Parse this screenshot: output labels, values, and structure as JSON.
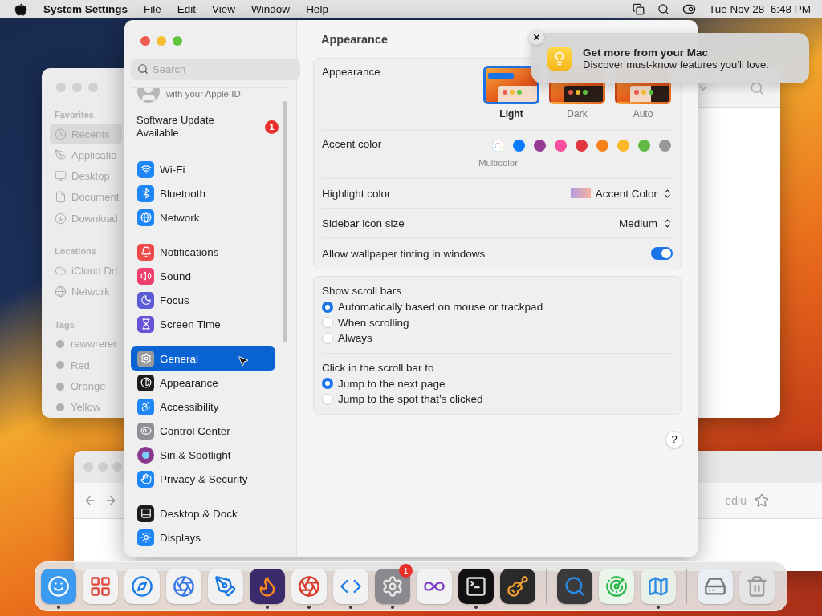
{
  "menubar": {
    "app": "System Settings",
    "menus": [
      "File",
      "Edit",
      "View",
      "Window",
      "Help"
    ],
    "clock": "Tue Nov 28  6:48 PM"
  },
  "finder": {
    "sections": [
      {
        "title": "Favorites",
        "kind": "places",
        "items": [
          {
            "label": "Recents",
            "selected": true
          },
          {
            "label": "Applicatio",
            "selected": false
          },
          {
            "label": "Desktop",
            "selected": false
          },
          {
            "label": "Document",
            "selected": false
          },
          {
            "label": "Download",
            "selected": false
          }
        ]
      },
      {
        "title": "Locations",
        "kind": "places",
        "items": [
          {
            "label": "iCloud Dri",
            "selected": false
          },
          {
            "label": "Network",
            "selected": false
          }
        ]
      },
      {
        "title": "Tags",
        "kind": "tags",
        "items": [
          {
            "label": "rewwrerer",
            "selected": false
          },
          {
            "label": "Red",
            "selected": false
          },
          {
            "label": "Orange",
            "selected": false
          },
          {
            "label": "Yellow",
            "selected": false
          }
        ]
      }
    ]
  },
  "browser": {
    "address_text": "ediu"
  },
  "settings": {
    "search": {
      "placeholder": "Search"
    },
    "account": {
      "subtitle": "with your Apple ID"
    },
    "update": {
      "label": "Software Update Available",
      "badge": "1"
    },
    "sidebar_groups": [
      [
        {
          "label": "Wi-Fi",
          "color": "#1e86f5",
          "selected": false
        },
        {
          "label": "Bluetooth",
          "color": "#1e86f5",
          "selected": false
        },
        {
          "label": "Network",
          "color": "#1e86f5",
          "selected": false
        }
      ],
      [
        {
          "label": "Notifications",
          "color": "#ec4a4a",
          "selected": false
        },
        {
          "label": "Sound",
          "color": "#ec3f6b",
          "selected": false
        },
        {
          "label": "Focus",
          "color": "#5b5bd6",
          "selected": false
        },
        {
          "label": "Screen Time",
          "color": "#6a52d8",
          "selected": false
        }
      ],
      [
        {
          "label": "General",
          "color": "#9a9a9e",
          "selected": true
        },
        {
          "label": "Appearance",
          "color": "#1c1c1e",
          "selected": false
        },
        {
          "label": "Accessibility",
          "color": "#1e86f5",
          "selected": false
        },
        {
          "label": "Control Center",
          "color": "#8e8e93",
          "selected": false
        },
        {
          "label": "Siri & Spotlight",
          "color": "#8a3a8e",
          "selected": false
        },
        {
          "label": "Privacy & Security",
          "color": "#1e86f5",
          "selected": false
        }
      ],
      [
        {
          "label": "Desktop & Dock",
          "color": "#1c1c1e",
          "selected": false
        },
        {
          "label": "Displays",
          "color": "#1e86f5",
          "selected": false
        }
      ]
    ],
    "content": {
      "title": "Appearance",
      "rows": [
        {
          "kind": "appearance",
          "label": "Appearance",
          "options": [
            {
              "kind": "light",
              "label": "Light",
              "selected": true
            },
            {
              "kind": "dark",
              "label": "Dark",
              "selected": false
            },
            {
              "kind": "auto",
              "label": "Auto",
              "selected": false
            }
          ]
        },
        {
          "kind": "accent",
          "label": "Accent color",
          "swatches": [
            {
              "kind": "multicolor",
              "label": "Multicolor",
              "selected": true
            },
            {
              "kind": "solid",
              "color": "#0a7aff",
              "selected": false
            },
            {
              "kind": "solid",
              "color": "#953d96",
              "selected": false
            },
            {
              "kind": "solid",
              "color": "#f74f9e",
              "selected": false
            },
            {
              "kind": "solid",
              "color": "#e0383e",
              "selected": false
            },
            {
              "kind": "solid",
              "color": "#f7821b",
              "selected": false
            },
            {
              "kind": "solid",
              "color": "#fcb827",
              "selected": false
            },
            {
              "kind": "solid",
              "color": "#62ba46",
              "selected": false
            },
            {
              "kind": "solid",
              "color": "#989898",
              "selected": false
            }
          ]
        },
        {
          "kind": "popup",
          "label": "Highlight color",
          "value": "Accent Color",
          "preview": true
        },
        {
          "kind": "popup",
          "label": "Sidebar icon size",
          "value": "Medium",
          "preview": false
        },
        {
          "kind": "toggle",
          "label": "Allow wallpaper tinting in windows",
          "on": true
        }
      ],
      "radio_groups": [
        {
          "title": "Show scroll bars",
          "options": [
            {
              "label": "Automatically based on mouse or trackpad",
              "selected": true
            },
            {
              "label": "When scrolling",
              "selected": false
            },
            {
              "label": "Always",
              "selected": false
            }
          ]
        },
        {
          "title": "Click in the scroll bar to",
          "options": [
            {
              "label": "Jump to the next page",
              "selected": true
            },
            {
              "label": "Jump to the spot that’s clicked",
              "selected": false
            }
          ]
        }
      ],
      "help": "?"
    }
  },
  "notification": {
    "title": "Get more from your Mac",
    "body": "Discover must-know features you’ll love."
  },
  "dock": {
    "sections": [
      {
        "items": [
          {
            "running": true,
            "color": "#3a9bf0"
          },
          {
            "running": false,
            "color": "#f2f2f2"
          },
          {
            "running": false,
            "color": "#f2f2f2"
          },
          {
            "running": false,
            "color": "#f2f2f2"
          },
          {
            "running": false,
            "color": "#f2f2f2"
          },
          {
            "running": true,
            "color": "#3a2a6a"
          },
          {
            "running": true,
            "color": "#f2f2f2"
          },
          {
            "running": true,
            "color": "#f2f2f2"
          },
          {
            "running": true,
            "color": "#8a8a8e",
            "badge": "1"
          },
          {
            "running": false,
            "color": "#f2f2f2"
          },
          {
            "running": true,
            "color": "#111111"
          },
          {
            "running": false,
            "color": "#2a2a2a"
          }
        ]
      },
      {
        "items": [
          {
            "running": false,
            "color": "#3a3a3c"
          },
          {
            "running": false,
            "color": "#e8f5e8"
          },
          {
            "running": true,
            "color": "#e8f0e8"
          }
        ]
      },
      {
        "items": [
          {
            "running": false,
            "color": "#e8eef4"
          },
          {
            "running": false,
            "color": "#e4e4e4"
          }
        ]
      }
    ]
  }
}
